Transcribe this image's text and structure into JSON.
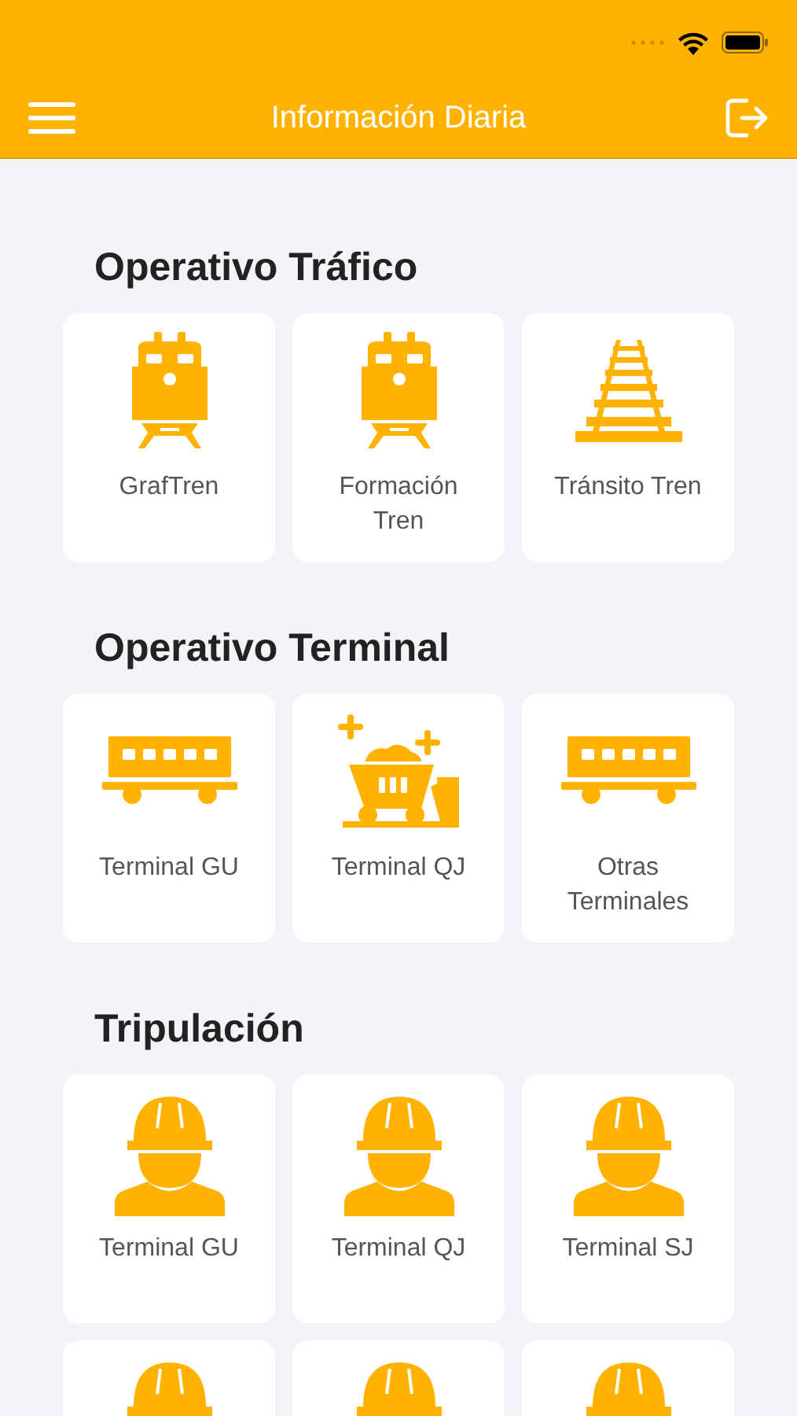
{
  "nav_bar": {
    "title": "Información Diaria"
  },
  "sections": [
    {
      "title": "Operativo Tráfico",
      "tiles": [
        {
          "kind": "locomotive",
          "label": "GrafTren"
        },
        {
          "kind": "locomotive",
          "label": "Formación Tren"
        },
        {
          "kind": "track",
          "label": "Tránsito Tren"
        }
      ]
    },
    {
      "title": "Operativo Terminal",
      "tiles": [
        {
          "kind": "wagon",
          "label": "Terminal GU"
        },
        {
          "kind": "mine-cart",
          "label": "Terminal QJ"
        },
        {
          "kind": "wagon",
          "label": "Otras Terminales"
        }
      ]
    },
    {
      "title": "Tripulación",
      "tiles": [
        {
          "kind": "worker",
          "label": "Terminal GU"
        },
        {
          "kind": "worker",
          "label": "Terminal QJ"
        },
        {
          "kind": "worker",
          "label": "Terminal SJ"
        },
        {
          "kind": "worker"
        },
        {
          "kind": "worker"
        },
        {
          "kind": "worker"
        }
      ]
    }
  ]
}
